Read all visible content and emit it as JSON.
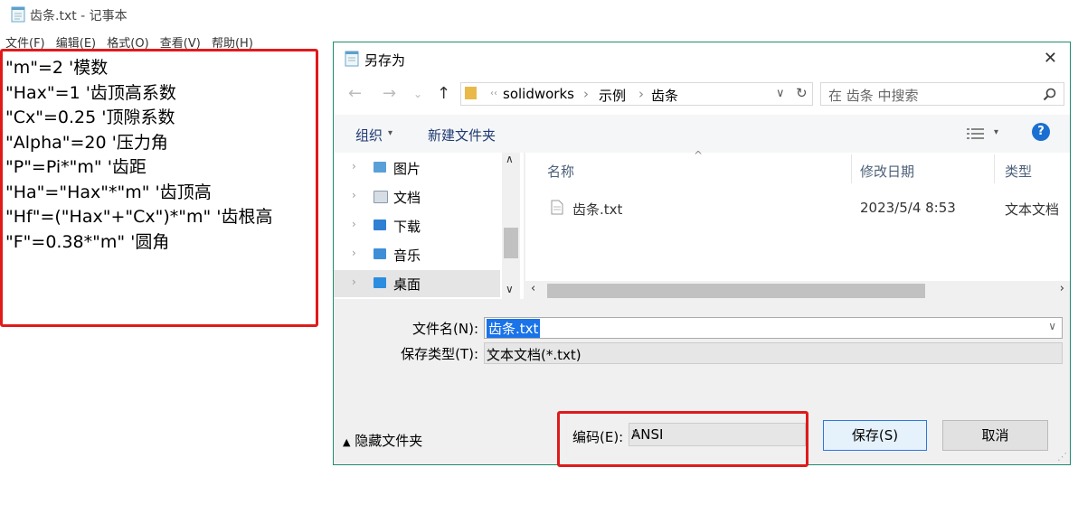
{
  "notepad": {
    "title": "齿条.txt - 记事本",
    "menu": [
      "文件(F)",
      "编辑(E)",
      "格式(O)",
      "查看(V)",
      "帮助(H)"
    ],
    "lines": [
      "\"m\"=2 '模数",
      "\"Hax\"=1 '齿顶高系数",
      "\"Cx\"=0.25 '顶隙系数",
      "\"Alpha\"=20 '压力角",
      "\"P\"=Pi*\"m\" '齿距",
      "\"Ha\"=\"Hax\"*\"m\" '齿顶高",
      "\"Hf\"=(\"Hax\"+\"Cx\")*\"m\" '齿根高",
      "\"F\"=0.38*\"m\" '圆角"
    ]
  },
  "dialog": {
    "title": "另存为",
    "close_glyph": "✕",
    "breadcrumb": [
      "solidworks",
      "示例",
      "齿条"
    ],
    "search_placeholder": "在 齿条 中搜索",
    "toolbar": {
      "organize": "组织",
      "new_folder": "新建文件夹"
    },
    "help_glyph": "?",
    "nav_items": [
      "图片",
      "文档",
      "下载",
      "音乐",
      "桌面"
    ],
    "columns": {
      "name": "名称",
      "date": "修改日期",
      "type": "类型"
    },
    "files": [
      {
        "name": "齿条.txt",
        "date": "2023/5/4 8:53",
        "type": "文本文档"
      }
    ],
    "filename_label": "文件名(N):",
    "filename_value": "齿条.txt",
    "filetype_label": "保存类型(T):",
    "filetype_value": "文本文档(*.txt)",
    "hide_folders": "隐藏文件夹",
    "encoding_label": "编码(E):",
    "encoding_value": "ANSI",
    "save_button": "保存(S)",
    "cancel_button": "取消"
  },
  "colors": {
    "highlight_red": "#e01a1a",
    "dialog_border": "#1e8c6e",
    "selection_blue": "#1a73e8"
  }
}
